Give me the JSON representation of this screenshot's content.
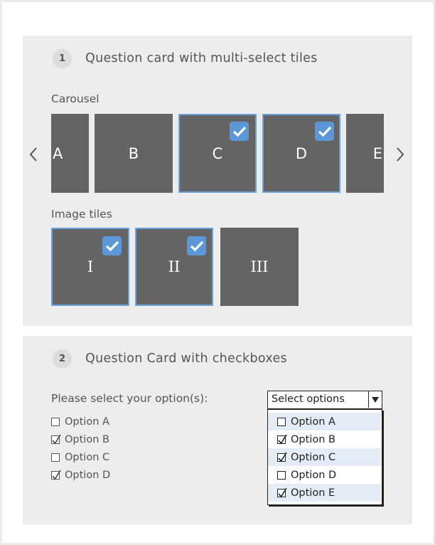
{
  "section1": {
    "number": "1",
    "title": "Question card with multi-select tiles",
    "carousel_label": "Carousel",
    "carousel_tiles": [
      {
        "label": "A",
        "selected": false
      },
      {
        "label": "B",
        "selected": false
      },
      {
        "label": "C",
        "selected": true
      },
      {
        "label": "D",
        "selected": true
      },
      {
        "label": "E",
        "selected": false
      }
    ],
    "image_tiles_label": "Image tiles",
    "image_tiles": [
      {
        "label": "I",
        "selected": true
      },
      {
        "label": "II",
        "selected": true
      },
      {
        "label": "III",
        "selected": false
      }
    ]
  },
  "section2": {
    "number": "2",
    "title": "Question Card with checkboxes",
    "prompt": "Please select your option(s):",
    "checkbox_options": [
      {
        "label": "Option A",
        "checked": false
      },
      {
        "label": "Option B",
        "checked": true
      },
      {
        "label": "Option C",
        "checked": false
      },
      {
        "label": "Option D",
        "checked": true
      }
    ],
    "dropdown": {
      "placeholder": "Select options",
      "options": [
        {
          "label": "Option A",
          "checked": false
        },
        {
          "label": "Option B",
          "checked": true
        },
        {
          "label": "Option C",
          "checked": true
        },
        {
          "label": "Option D",
          "checked": false
        },
        {
          "label": "Option E",
          "checked": true
        }
      ]
    }
  },
  "colors": {
    "card_bg": "#ececec",
    "tile_bg": "#646464",
    "selected_border": "#6aa2dc",
    "check_badge": "#5c97d8",
    "dropdown_alt_row": "#e6ecf5"
  },
  "icons": [
    "chevron-left-icon",
    "chevron-right-icon",
    "checkmark-icon",
    "dropdown-arrow-icon",
    "checkbox-icon"
  ]
}
